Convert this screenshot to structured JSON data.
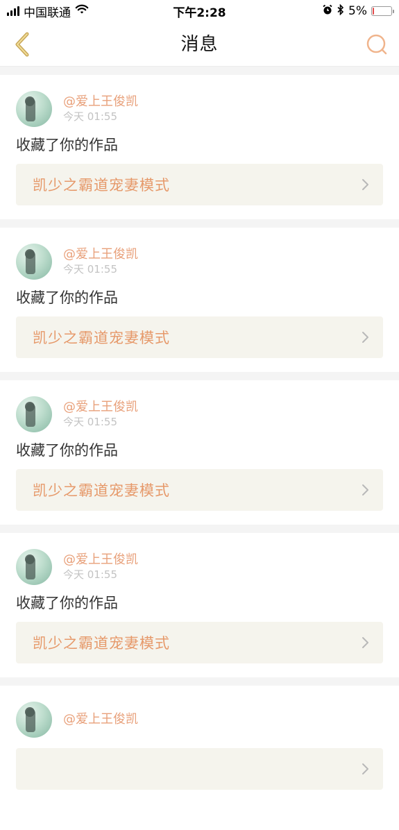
{
  "status_bar": {
    "carrier": "中国联通",
    "time": "下午2:28",
    "battery_percent": "5%",
    "battery_level": 0.05,
    "icons": [
      "signal-icon",
      "wifi-icon",
      "alarm-icon",
      "bluetooth-icon",
      "battery-icon"
    ]
  },
  "nav": {
    "title": "消息",
    "back_icon": "chevron-left-icon",
    "search_icon": "search-icon",
    "accent": "#e8a07a",
    "back_color": "#c9a85a"
  },
  "messages": [
    {
      "username": "@爱上王俊凯",
      "time": "今天 01:55",
      "action": "收藏了你的作品",
      "work_title": "凯少之霸道宠妻模式"
    },
    {
      "username": "@爱上王俊凯",
      "time": "今天 01:55",
      "action": "收藏了你的作品",
      "work_title": "凯少之霸道宠妻模式"
    },
    {
      "username": "@爱上王俊凯",
      "time": "今天 01:55",
      "action": "收藏了你的作品",
      "work_title": "凯少之霸道宠妻模式"
    },
    {
      "username": "@爱上王俊凯",
      "time": "今天 01:55",
      "action": "收藏了你的作品",
      "work_title": "凯少之霸道宠妻模式"
    },
    {
      "username": "@爱上王俊凯",
      "time": "",
      "action": "",
      "work_title": ""
    }
  ]
}
